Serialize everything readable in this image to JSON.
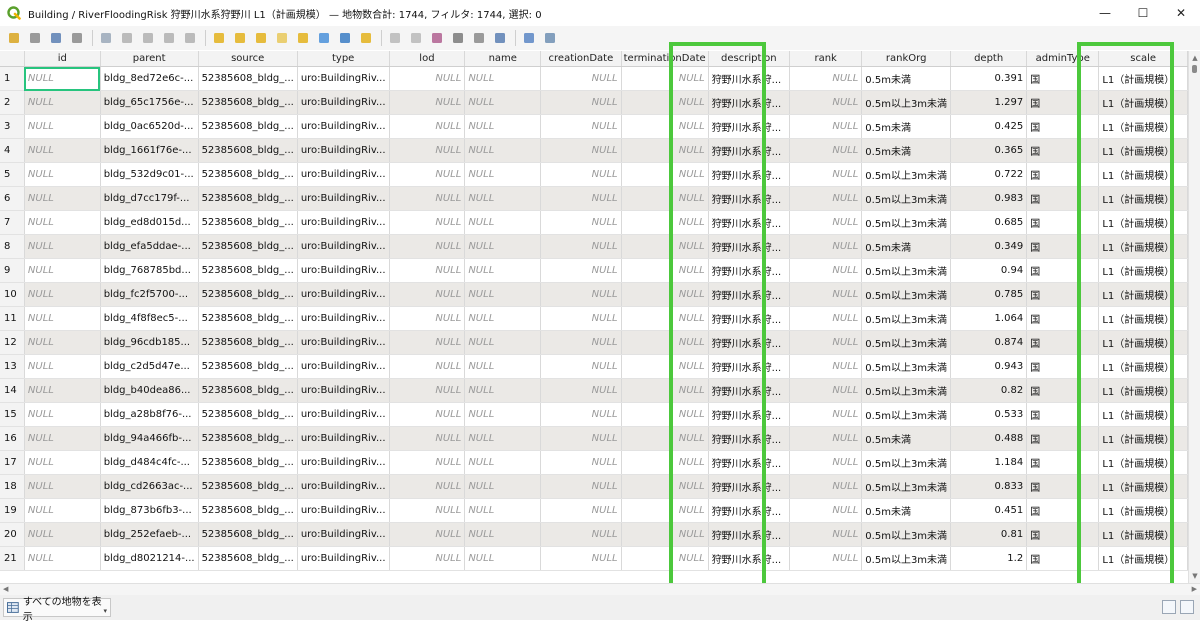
{
  "window": {
    "title": "Building / RiverFloodingRisk 狩野川水系狩野川 L1（計画規模） — 地物数合計: 1744, フィルタ: 1744, 選択: 0",
    "minimize_glyph": "—",
    "maximize_glyph": "☐",
    "close_glyph": "✕"
  },
  "toolbar": {
    "icons": [
      "pencil-icon",
      "multi-edit-icon",
      "save-edits-icon",
      "reload-icon",
      "add-feature-icon",
      "delete-feature-icon",
      "cut-icon",
      "copy-icon",
      "paste-icon",
      "expression-select-icon",
      "select-all-icon",
      "invert-selection-icon",
      "deselect-all-icon",
      "filter-select-icon",
      "move-selection-top-icon",
      "pan-to-selection-icon",
      "zoom-to-selection-icon",
      "copy-rows-icon",
      "paste-rows-icon",
      "new-field-icon",
      "delete-field-icon",
      "field-calculator-icon",
      "conditional-formatting-icon",
      "actions-icon",
      "dock-icon"
    ]
  },
  "table": {
    "columns": [
      "id",
      "parent",
      "source",
      "type",
      "lod",
      "name",
      "creationDate",
      "terminationDate",
      "description",
      "rank",
      "rankOrg",
      "depth",
      "adminType",
      "scale"
    ],
    "null_text": "NULL",
    "rows": [
      {
        "n": "1",
        "parent": "bldg_8ed72e6c-...",
        "rankOrg": "0.5m未満",
        "depth": "0.391"
      },
      {
        "n": "2",
        "parent": "bldg_65c1756e-...",
        "rankOrg": "0.5m以上3m未満",
        "depth": "1.297"
      },
      {
        "n": "3",
        "parent": "bldg_0ac6520d-...",
        "rankOrg": "0.5m未満",
        "depth": "0.425"
      },
      {
        "n": "4",
        "parent": "bldg_1661f76e-...",
        "rankOrg": "0.5m未満",
        "depth": "0.365"
      },
      {
        "n": "5",
        "parent": "bldg_532d9c01-...",
        "rankOrg": "0.5m以上3m未満",
        "depth": "0.722"
      },
      {
        "n": "6",
        "parent": "bldg_d7cc179f-...",
        "rankOrg": "0.5m以上3m未満",
        "depth": "0.983"
      },
      {
        "n": "7",
        "parent": "bldg_ed8d015d...",
        "rankOrg": "0.5m以上3m未満",
        "depth": "0.685"
      },
      {
        "n": "8",
        "parent": "bldg_efa5ddae-...",
        "rankOrg": "0.5m未満",
        "depth": "0.349"
      },
      {
        "n": "9",
        "parent": "bldg_768785bd...",
        "rankOrg": "0.5m以上3m未満",
        "depth": "0.94"
      },
      {
        "n": "10",
        "parent": "bldg_fc2f5700-...",
        "rankOrg": "0.5m以上3m未満",
        "depth": "0.785"
      },
      {
        "n": "11",
        "parent": "bldg_4f8f8ec5-...",
        "rankOrg": "0.5m以上3m未満",
        "depth": "1.064"
      },
      {
        "n": "12",
        "parent": "bldg_96cdb185...",
        "rankOrg": "0.5m以上3m未満",
        "depth": "0.874"
      },
      {
        "n": "13",
        "parent": "bldg_c2d5d47e...",
        "rankOrg": "0.5m以上3m未満",
        "depth": "0.943"
      },
      {
        "n": "14",
        "parent": "bldg_b40dea86...",
        "rankOrg": "0.5m以上3m未満",
        "depth": "0.82"
      },
      {
        "n": "15",
        "parent": "bldg_a28b8f76-...",
        "rankOrg": "0.5m以上3m未満",
        "depth": "0.533"
      },
      {
        "n": "16",
        "parent": "bldg_94a466fb-...",
        "rankOrg": "0.5m未満",
        "depth": "0.488"
      },
      {
        "n": "17",
        "parent": "bldg_d484c4fc-...",
        "rankOrg": "0.5m以上3m未満",
        "depth": "1.184"
      },
      {
        "n": "18",
        "parent": "bldg_cd2663ac-...",
        "rankOrg": "0.5m以上3m未満",
        "depth": "0.833"
      },
      {
        "n": "19",
        "parent": "bldg_873b6fb3-...",
        "rankOrg": "0.5m未満",
        "depth": "0.451"
      },
      {
        "n": "20",
        "parent": "bldg_252efaeb-...",
        "rankOrg": "0.5m以上3m未満",
        "depth": "0.81"
      },
      {
        "n": "21",
        "parent": "bldg_d8021214-...",
        "rankOrg": "0.5m以上3m未満",
        "depth": "1.2"
      }
    ],
    "common": {
      "source": "52385608_bldg_...",
      "type": "uro:BuildingRiv...",
      "description": "狩野川水系狩...",
      "adminType": "国",
      "scale": "L1（計画規模）"
    }
  },
  "statusbar": {
    "filter_button_label": "すべての地物を表示",
    "dropdown_glyph": "▾"
  },
  "colors": {
    "highlight_box": "#4cc83c",
    "selected_cell_border": "#27c47e",
    "alt_row": "#ebe9e6"
  }
}
